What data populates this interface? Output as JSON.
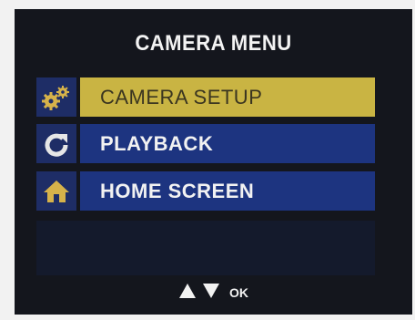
{
  "screen": {
    "title": "CAMERA MENU",
    "items": [
      {
        "label": "CAMERA SETUP",
        "icon": "gears-icon",
        "selected": true
      },
      {
        "label": "PLAYBACK",
        "icon": "refresh-icon",
        "selected": false
      },
      {
        "label": "HOME SCREEN",
        "icon": "home-icon",
        "selected": false
      }
    ],
    "hint": {
      "ok_label": "OK"
    }
  },
  "colors": {
    "background": "#14161d",
    "item_bar": "#1d3480",
    "item_selected": "#c9b443",
    "icon_accent": "#d6b24a"
  }
}
